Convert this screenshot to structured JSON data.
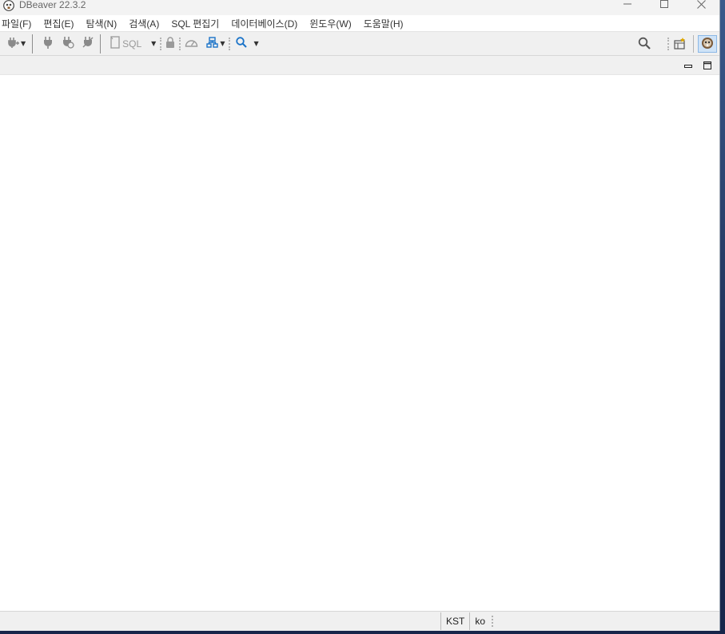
{
  "window": {
    "title": "DBeaver 22.3.2",
    "controls": {
      "minimize": "—",
      "maximize": "☐",
      "close": "✕"
    }
  },
  "menubar": {
    "items": [
      {
        "label": "파일(F)"
      },
      {
        "label": "편집(E)"
      },
      {
        "label": "탐색(N)"
      },
      {
        "label": "검색(A)"
      },
      {
        "label": "SQL 편집기"
      },
      {
        "label": "데이터베이스(D)"
      },
      {
        "label": "윈도우(W)"
      },
      {
        "label": "도움말(H)"
      }
    ]
  },
  "toolbar": {
    "sql_label": "SQL",
    "icons": [
      "new-connection-icon",
      "connect-icon",
      "reconnect-icon",
      "disconnect-icon",
      "sql-editor-icon",
      "lock-icon",
      "dashboard-icon",
      "database-navigator-icon",
      "search-icon",
      "global-search-icon",
      "perspective-icon",
      "dbeaver-perspective-icon"
    ],
    "accent": "#1a73c8"
  },
  "statusbar": {
    "timezone": "KST",
    "locale": "ko"
  }
}
